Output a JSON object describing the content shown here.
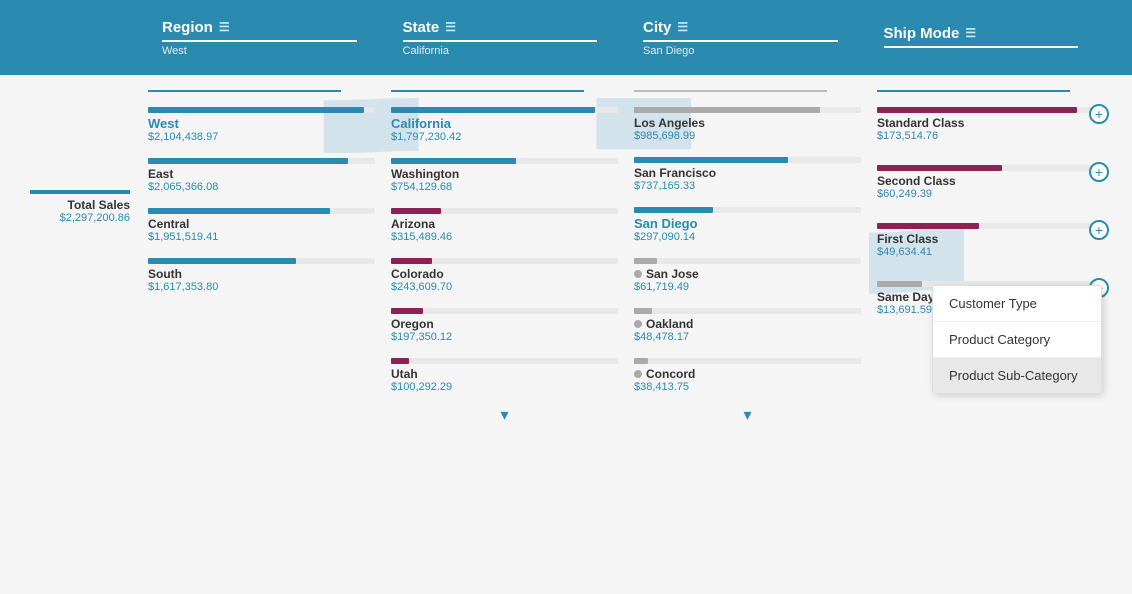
{
  "header": {
    "bg_color": "#2a8ab0",
    "columns": [
      {
        "id": "region",
        "title": "Region",
        "subtitle": "West"
      },
      {
        "id": "state",
        "title": "State",
        "subtitle": "California"
      },
      {
        "id": "city",
        "title": "City",
        "subtitle": "San Diego"
      },
      {
        "id": "shipmode",
        "title": "Ship Mode",
        "subtitle": ""
      }
    ]
  },
  "total_sales": {
    "label": "Total Sales",
    "value": "$2,297,200.86"
  },
  "regions": [
    {
      "name": "West",
      "value": "$2,104,438.97",
      "bar_pct": 95,
      "bar_color": "teal",
      "selected": true
    },
    {
      "name": "East",
      "value": "$2,065,366.08",
      "bar_pct": 88,
      "bar_color": "teal"
    },
    {
      "name": "Central",
      "value": "$1,951,519.41",
      "bar_pct": 80,
      "bar_color": "teal"
    },
    {
      "name": "South",
      "value": "$1,617,353.80",
      "bar_pct": 65,
      "bar_color": "teal"
    }
  ],
  "states": [
    {
      "name": "California",
      "value": "$1,797,230.42",
      "bar_pct": 90,
      "bar_color": "teal",
      "selected": true
    },
    {
      "name": "Washington",
      "value": "$754,129.68",
      "bar_pct": 55,
      "bar_color": "teal"
    },
    {
      "name": "Arizona",
      "value": "$315,489.46",
      "bar_pct": 22,
      "bar_color": "purple"
    },
    {
      "name": "Colorado",
      "value": "$243,609.70",
      "bar_pct": 18,
      "bar_color": "purple"
    },
    {
      "name": "Oregon",
      "value": "$197,350.12",
      "bar_pct": 14,
      "bar_color": "purple"
    },
    {
      "name": "Utah",
      "value": "$100,292.29",
      "bar_pct": 8,
      "bar_color": "purple"
    }
  ],
  "cities": [
    {
      "name": "Los Angeles",
      "value": "$985,698.99",
      "bar_pct": 82,
      "bar_color": "gray"
    },
    {
      "name": "San Francisco",
      "value": "$737,165.33",
      "bar_pct": 68,
      "bar_color": "teal"
    },
    {
      "name": "San Diego",
      "value": "$297,090.14",
      "bar_pct": 35,
      "bar_color": "teal",
      "selected": true
    },
    {
      "name": "San Jose",
      "value": "$61,719.49",
      "bar_pct": 10,
      "bar_color": "dot-gray"
    },
    {
      "name": "Oakland",
      "value": "$48,478.17",
      "bar_pct": 8,
      "bar_color": "dot-gray"
    },
    {
      "name": "Concord",
      "value": "$38,413.75",
      "bar_pct": 6,
      "bar_color": "dot-gray"
    }
  ],
  "shipmodes": [
    {
      "name": "Standard Class",
      "value": "$173,514.76",
      "bar_pct": 88,
      "bar_color": "purple"
    },
    {
      "name": "Second Class",
      "value": "$60,249.39",
      "bar_pct": 55,
      "bar_color": "purple"
    },
    {
      "name": "First Class",
      "value": "$49,634.41",
      "bar_pct": 45,
      "bar_color": "purple"
    },
    {
      "name": "Same Day",
      "value": "$13,691.59",
      "bar_pct": 20,
      "bar_color": "gray"
    }
  ],
  "dropdown": {
    "items": [
      {
        "label": "Customer Type",
        "highlighted": false
      },
      {
        "label": "Product Category",
        "highlighted": false
      },
      {
        "label": "Product Sub-Category",
        "highlighted": true
      }
    ]
  },
  "down_arrow": "▾"
}
